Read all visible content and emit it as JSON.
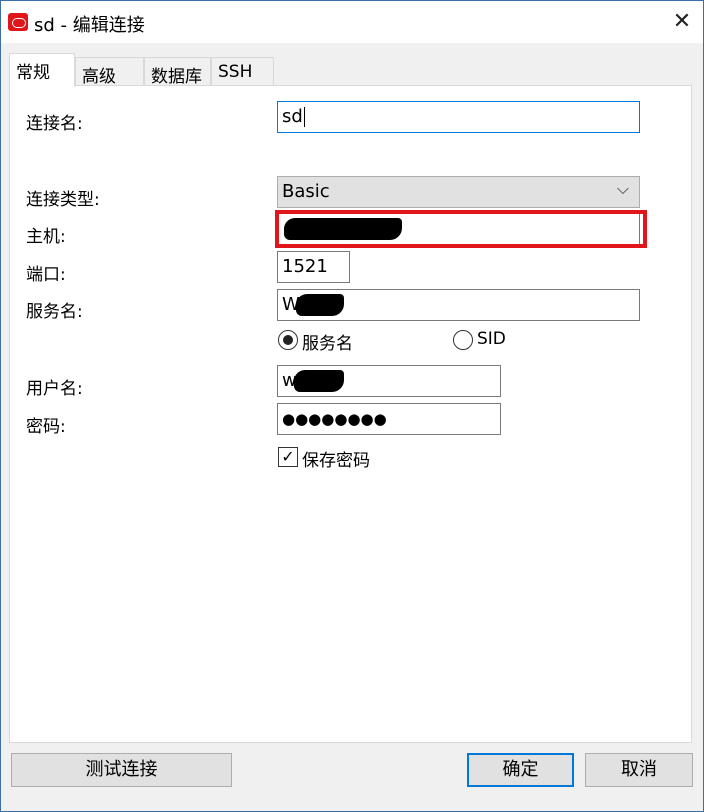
{
  "window": {
    "title": "sd - 编辑连接",
    "brand_color": "#e0161b",
    "focus_color": "#0078d7",
    "close_glyph": "✕"
  },
  "tabs": [
    {
      "label": "常规",
      "active": true
    },
    {
      "label": "高级",
      "active": false
    },
    {
      "label": "数据库",
      "active": false
    },
    {
      "label": "SSH",
      "active": false
    }
  ],
  "form": {
    "connection_name_label": "连接名:",
    "connection_name_value": "sd",
    "connection_type_label": "连接类型:",
    "connection_type_value": "Basic",
    "host_label": "主机:",
    "host_value": "",
    "port_label": "端口:",
    "port_value": "1521",
    "service_label": "服务名:",
    "service_value_prefix": "W",
    "radio_service_label": "服务名",
    "radio_sid_label": "SID",
    "radio_selected": "服务名",
    "username_label": "用户名:",
    "username_value_prefix": "w",
    "password_label": "密码:",
    "password_value": "●●●●●●●●",
    "save_password_label": "保存密码",
    "save_password_checked": true
  },
  "buttons": {
    "test": "测试连接",
    "ok": "确定",
    "cancel": "取消"
  }
}
